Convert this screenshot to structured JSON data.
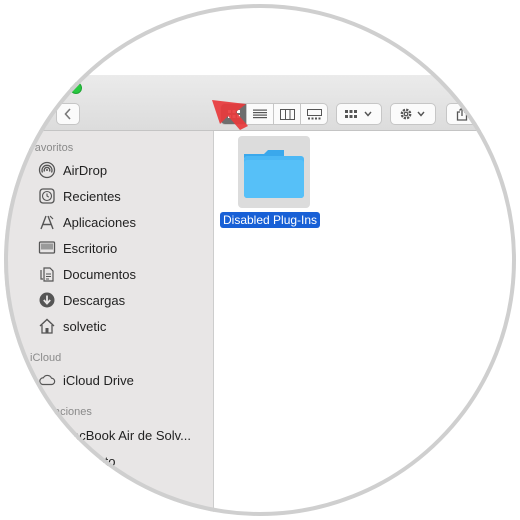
{
  "toolbar": {
    "back_icon": "chevron-left-icon",
    "view_modes": [
      "icon-view-icon",
      "list-view-icon",
      "column-view-icon",
      "gallery-view-icon"
    ],
    "active_view": "icon-view-icon",
    "group_menu_icon": "group-by-icon",
    "action_menu_icon": "gear-icon",
    "share_icon": "share-icon"
  },
  "sidebar": {
    "favorites_header": "Favoritos",
    "favorites": [
      {
        "label": "AirDrop",
        "icon": "airdrop-icon"
      },
      {
        "label": "Recientes",
        "icon": "clock-icon"
      },
      {
        "label": "Aplicaciones",
        "icon": "applications-icon"
      },
      {
        "label": "Escritorio",
        "icon": "desktop-icon"
      },
      {
        "label": "Documentos",
        "icon": "document-icon"
      },
      {
        "label": "Descargas",
        "icon": "download-icon"
      },
      {
        "label": "solvetic",
        "icon": "home-icon"
      }
    ],
    "icloud_header": "iCloud",
    "icloud": [
      {
        "label": "iCloud Drive",
        "icon": "cloud-icon"
      }
    ],
    "locations_header": "aciones",
    "locations": [
      {
        "label": "acBook Air de Solv...",
        "icon": "laptop-icon"
      },
      {
        "label": "remoto",
        "icon": "disc-icon"
      }
    ]
  },
  "content": {
    "selected_item": {
      "label": "Disabled Plug-Ins",
      "icon": "folder-icon"
    }
  },
  "colors": {
    "selection": "#1860d6",
    "folder": "#4cb8f5",
    "annotation_arrow": "#e8393c"
  }
}
